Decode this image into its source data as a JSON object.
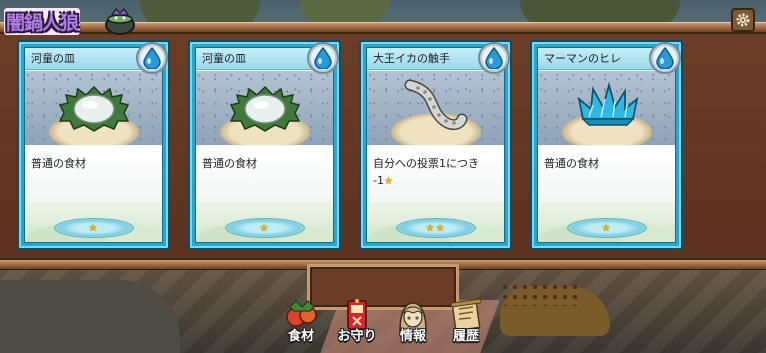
{
  "game": {
    "logo_text": "闇鍋人狼"
  },
  "cards": [
    {
      "title": "河童の皿",
      "description": "普通の食材",
      "stars": "★",
      "element": "water-drop"
    },
    {
      "title": "河童の皿",
      "description": "普通の食材",
      "stars": "★",
      "element": "water-drop"
    },
    {
      "title": "大王イカの触手",
      "description": "自分への投票1につき",
      "description_line2": "-1",
      "inline_star": "★",
      "stars": "★★",
      "element": "water-drop"
    },
    {
      "title": "マーマンのヒレ",
      "description": "普通の食材",
      "stars": "★",
      "element": "water-drop"
    }
  ],
  "menu": [
    {
      "label": "食材",
      "icon": "vegetables-icon"
    },
    {
      "label": "お守り",
      "icon": "amulet-icon"
    },
    {
      "label": "情報",
      "icon": "character-portrait-icon"
    },
    {
      "label": "履歴",
      "icon": "scroll-icon"
    }
  ],
  "colors": {
    "card_frame": "#2aa6c8",
    "panel_wood": "#6b3d27",
    "star": "#f0b400",
    "logo_purple": "#b27ee6"
  }
}
